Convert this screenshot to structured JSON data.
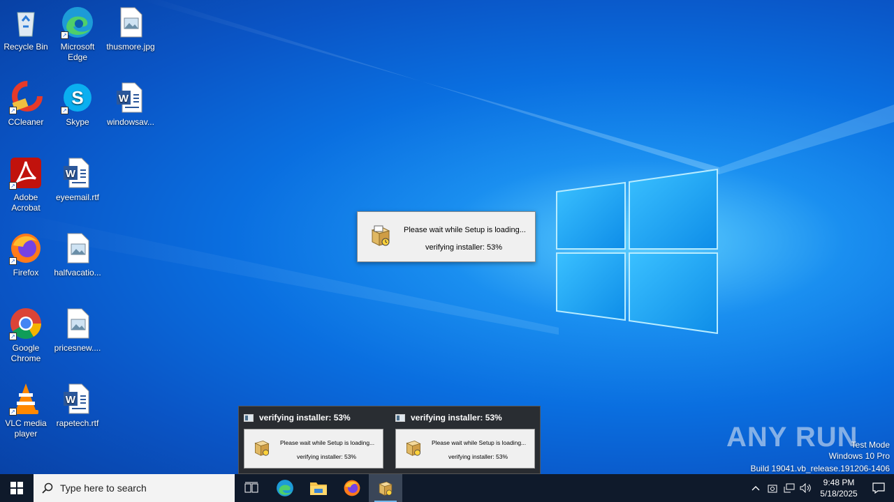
{
  "desktop": {
    "icons": [
      {
        "label": "Recycle Bin"
      },
      {
        "label": "Microsoft Edge"
      },
      {
        "label": "thusmore.jpg"
      },
      {
        "label": "CCleaner"
      },
      {
        "label": "Skype"
      },
      {
        "label": "windowsav..."
      },
      {
        "label": "Adobe Acrobat"
      },
      {
        "label": "eyeemail.rtf"
      },
      {
        "label": "Firefox"
      },
      {
        "label": "halfvacatio..."
      },
      {
        "label": "Google Chrome"
      },
      {
        "label": "pricesnew...."
      },
      {
        "label": "VLC media player"
      },
      {
        "label": "rapetech.rtf"
      }
    ]
  },
  "setup_dialog": {
    "message": "Please wait while Setup is loading...",
    "status": "verifying installer: 53%",
    "progress_percent": 53
  },
  "thumbnails": [
    {
      "title": "verifying installer: 53%",
      "message": "Please wait while Setup is loading...",
      "status": "verifying installer: 53%"
    },
    {
      "title": "verifying installer: 53%",
      "message": "Please wait while Setup is loading...",
      "status": "verifying installer: 53%"
    }
  ],
  "watermark": {
    "brand": "ANY RUN",
    "test_mode": "Test Mode",
    "os": "Windows 10 Pro",
    "build": "Build 19041.vb_release.191206-1406"
  },
  "taskbar": {
    "search_placeholder": "Type here to search",
    "pinned": [
      "task-view",
      "edge",
      "file-explorer",
      "firefox",
      "setup"
    ],
    "clock_time": "9:48 PM",
    "clock_date": "5/18/2025"
  },
  "colors": {
    "desktop_blue": "#0a6fe0",
    "taskbar": "#0f1a2b",
    "running_indicator": "#76b9ed"
  }
}
